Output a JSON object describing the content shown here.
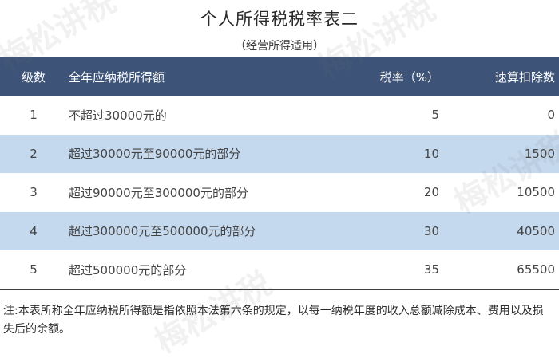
{
  "title": "个人所得税税率表二",
  "subtitle": "（经营所得适用）",
  "table": {
    "headers": [
      "级数",
      "全年应纳税所得额",
      "税率（%）",
      "速算扣除数"
    ],
    "rows": [
      {
        "level": "1",
        "range": "不超过30000元的",
        "rate": "5",
        "deduction": "0"
      },
      {
        "level": "2",
        "range": "超过30000元至90000元的部分",
        "rate": "10",
        "deduction": "1500"
      },
      {
        "level": "3",
        "range": "超过90000元至300000元的部分",
        "rate": "20",
        "deduction": "10500"
      },
      {
        "level": "4",
        "range": "超过300000元至500000元的部分",
        "rate": "30",
        "deduction": "40500"
      },
      {
        "level": "5",
        "range": "超过500000元的部分",
        "rate": "35",
        "deduction": "65500"
      }
    ]
  },
  "note": "注:本表所称全年应纳税所得额是指依照本法第六条的规定，以每一纳税年度的收入总额减除成本、费用以及损失后的余额。",
  "watermark": "梅松讲税",
  "colors": {
    "header_bg": "#3d5478",
    "shade_row": "#c4d8ee"
  }
}
